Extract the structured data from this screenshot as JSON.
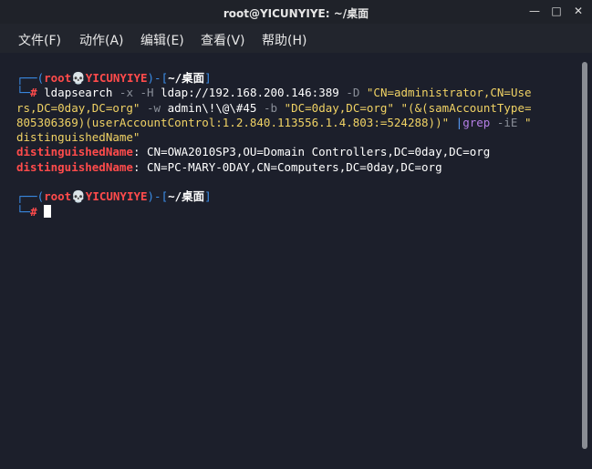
{
  "window": {
    "title": "root@YICUNYIYE: ~/桌面",
    "minimize_icon": "minimize-icon",
    "maximize_icon": "maximize-icon",
    "close_icon": "close-icon"
  },
  "menu": {
    "file": "文件(F)",
    "action": "动作(A)",
    "edit": "编辑(E)",
    "view": "查看(V)",
    "help": "帮助(H)"
  },
  "prompt": {
    "user": "root",
    "skull": "💀",
    "host": "YICUNYIYE",
    "path": "~/桌面",
    "symbol": "#"
  },
  "command": {
    "name": "ldapsearch",
    "f1": "-x",
    "f2": "-H",
    "host": "ldap://192.168.200.146:389",
    "f3": "-D",
    "binddn_a": "\"CN=administrator,CN=Use",
    "binddn_b": "rs,DC=0day,DC=org\"",
    "f4": "-w",
    "pass": "admin\\!\\@\\#45",
    "f5": "-b",
    "base": "\"DC=0day,DC=org\"",
    "filter_a": "\"(&(samAccountType=",
    "filter_b": "805306369)(userAccountControl:1.2.840.113556.1.4.803:=524288))\"",
    "pipe": "|",
    "grep": "grep",
    "grep_flag": "-iE",
    "pattern_a": "\"",
    "pattern_b": "distinguishedName\""
  },
  "output": [
    {
      "key": "distinguishedName",
      "value": ": CN=OWA2010SP3,OU=Domain Controllers,DC=0day,DC=org"
    },
    {
      "key": "distinguishedName",
      "value": ": CN=PC-MARY-0DAY,CN=Computers,DC=0day,DC=org"
    }
  ]
}
